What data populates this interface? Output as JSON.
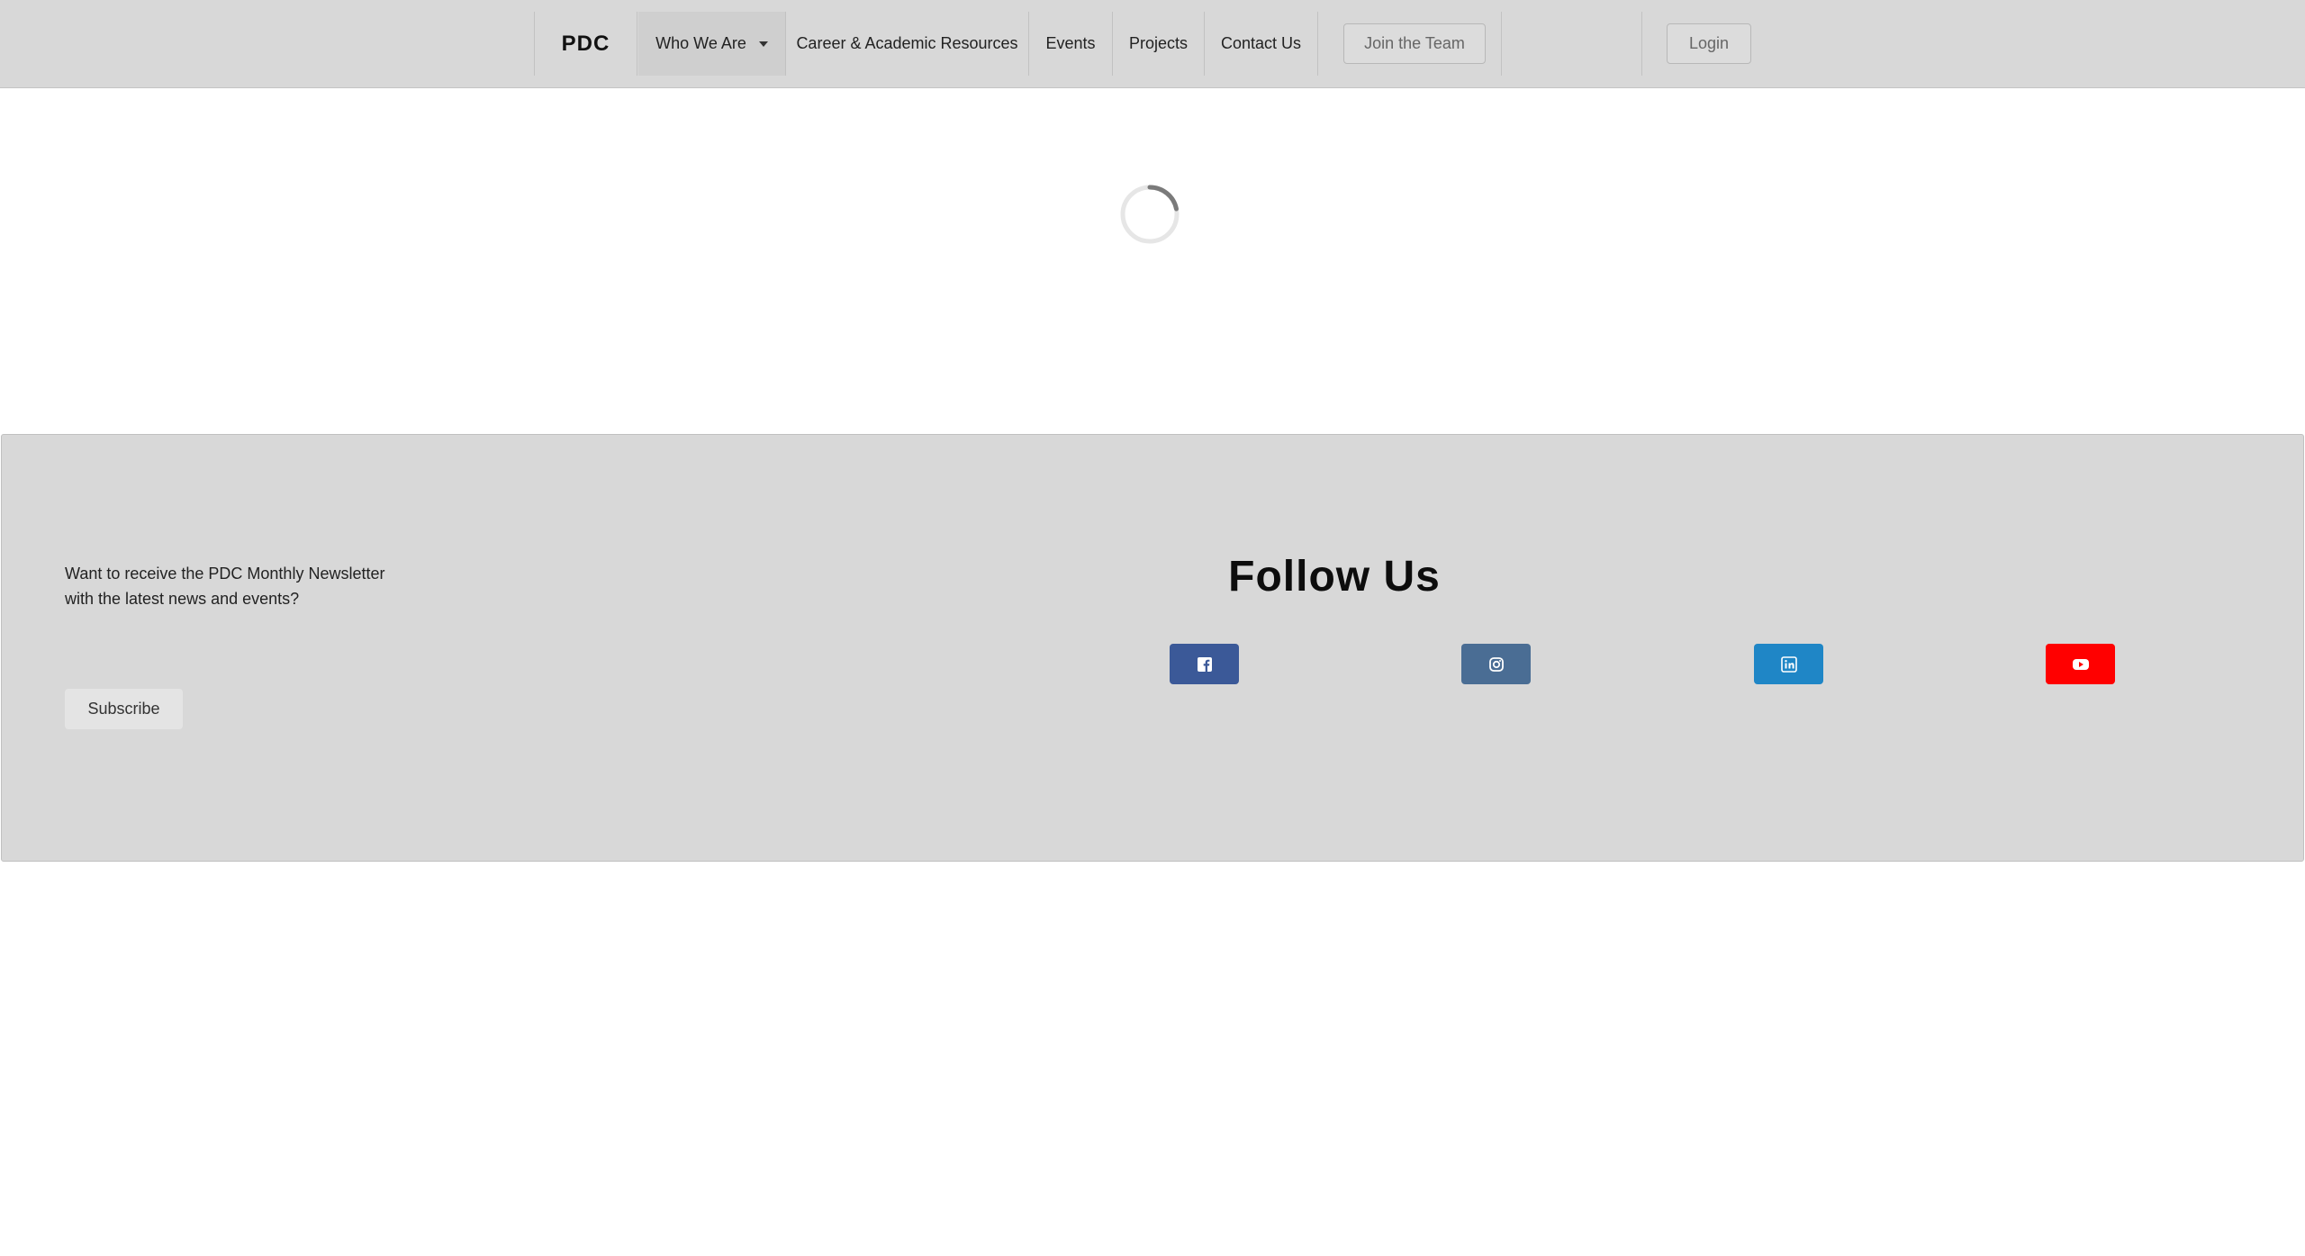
{
  "nav": {
    "brand": "PDC",
    "items": [
      {
        "label": "Who We Are",
        "has_dropdown": true,
        "active": true
      },
      {
        "label": "Career & Academic Resources"
      },
      {
        "label": "Events"
      },
      {
        "label": "Projects"
      },
      {
        "label": "Contact Us"
      }
    ],
    "join_label": "Join the Team",
    "login_label": "Login"
  },
  "loader": {
    "icon": "loading-spinner-icon"
  },
  "footer": {
    "newsletter_line1": "Want to receive the PDC Monthly Newsletter",
    "newsletter_line2": "with the latest news and events?",
    "subscribe_label": "Subscribe",
    "follow_title": "Follow Us",
    "social": [
      {
        "icon": "facebook-icon",
        "color": "#3b5998"
      },
      {
        "icon": "instagram-icon",
        "color": "#4a6d94"
      },
      {
        "icon": "linkedin-icon",
        "color": "#1f86c6"
      },
      {
        "icon": "youtube-icon",
        "color": "#ff0000"
      }
    ]
  }
}
